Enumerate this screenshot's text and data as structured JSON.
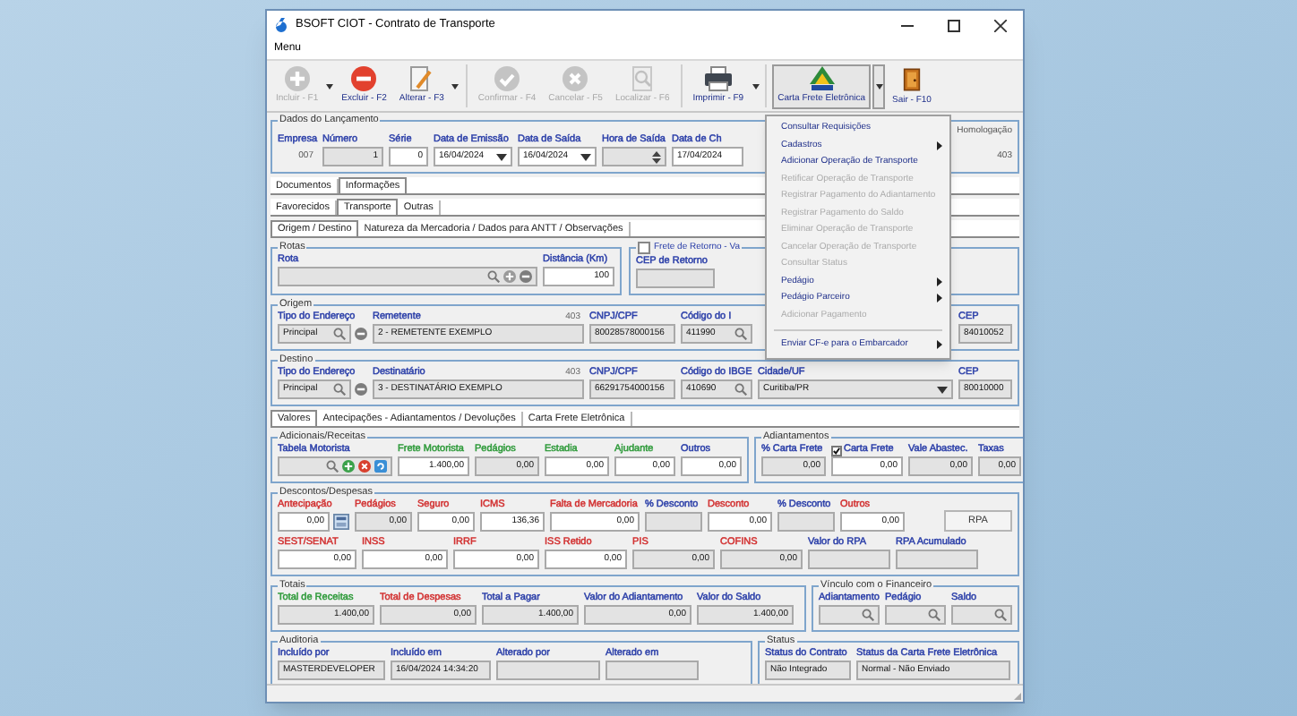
{
  "window": {
    "title": "BSOFT CIOT - Contrato de Transporte"
  },
  "menu_bar": [
    "Menu"
  ],
  "toolbar": [
    {
      "label": "Incluir - F1",
      "kind": "add",
      "disabled": true,
      "dropdown": true,
      "pressed": false
    },
    {
      "label": "Excluir - F2",
      "kind": "delete",
      "disabled": false,
      "dropdown": false,
      "pressed": false
    },
    {
      "label": "Alterar - F3",
      "kind": "edit",
      "disabled": false,
      "dropdown": true,
      "pressed": false
    },
    {
      "label": "Confirmar - F4",
      "kind": "confirm",
      "disabled": true,
      "dropdown": false,
      "pressed": false
    },
    {
      "label": "Cancelar - F5",
      "kind": "cancel",
      "disabled": true,
      "dropdown": false,
      "pressed": false
    },
    {
      "label": "Localizar - F6",
      "kind": "find",
      "disabled": true,
      "dropdown": false,
      "pressed": false
    },
    {
      "label": "Imprimir - F9",
      "kind": "print",
      "disabled": false,
      "dropdown": true,
      "pressed": false
    },
    {
      "label": "Carta Frete Eletrônica",
      "kind": "antt",
      "disabled": false,
      "dropdown": true,
      "pressed": true
    },
    {
      "label": "Sair - F10",
      "kind": "exit",
      "disabled": false,
      "dropdown": false,
      "pressed": false
    }
  ],
  "dados_lancamento": {
    "title": "Dados do Lançamento",
    "fields": [
      {
        "label": "Empresa",
        "value": "007",
        "kind": "static"
      },
      {
        "label": "Número",
        "value": "1",
        "kind": "number",
        "disabled": true
      },
      {
        "label": "Série",
        "value": "0",
        "kind": "number",
        "disabled": false
      },
      {
        "label": "Data de Emissão",
        "value": "16/04/2024",
        "kind": "date",
        "disabled": false
      },
      {
        "label": "Data de Saída",
        "value": "16/04/2024",
        "kind": "date",
        "disabled": false
      },
      {
        "label": "Hora de Saída",
        "kind": "time",
        "disabled": true
      },
      {
        "label": "Data de Ch",
        "value": "17/04/2024",
        "disabled": false
      }
    ],
    "homologacao": {
      "label": "Homologação",
      "value": "403"
    }
  },
  "tabs_main": [
    {
      "label": "Documentos",
      "selected": false
    },
    {
      "label": "Informações",
      "selected": true
    }
  ],
  "tabs_sub": [
    {
      "label": "Favorecidos",
      "selected": false
    },
    {
      "label": "Transporte",
      "selected": true
    },
    {
      "label": "Outras",
      "selected": false
    }
  ],
  "tabs_section": [
    {
      "label": "Origem / Destino",
      "selected": true
    },
    {
      "label": "Natureza da Mercadoria / Dados para ANTT / Observações",
      "selected": false
    }
  ],
  "rotas": {
    "title": "Rotas",
    "fields": [
      {
        "label": "Rota",
        "kind": "route",
        "disabled": true
      },
      {
        "label": "Distância (Km)",
        "value": "100",
        "kind": "number",
        "disabled": false
      }
    ]
  },
  "frete_retorno": {
    "label": "Frete de Retorno - Va",
    "checked": false,
    "fields": [
      {
        "label": "CEP de Retorno",
        "disabled": true
      }
    ]
  },
  "origem": {
    "title": "Origem",
    "fields": [
      {
        "label": "Tipo do Endereço",
        "value": "Principal",
        "kind": "address",
        "disabled": true
      },
      {
        "label": "Remetente",
        "value": "2 - REMETENTE EXEMPLO",
        "disabled": true,
        "note": "403"
      },
      {
        "label": "CNPJ/CPF",
        "value": "80028578000156",
        "disabled": true
      },
      {
        "label": "Código do I",
        "value": "411990",
        "kind": "lookup",
        "disabled": true
      },
      {
        "label": "CEP",
        "value": "84010052",
        "disabled": true
      }
    ]
  },
  "destino": {
    "title": "Destino",
    "fields": [
      {
        "label": "Tipo do Endereço",
        "value": "Principal",
        "kind": "address",
        "disabled": true
      },
      {
        "label": "Destinatário",
        "value": "3 - DESTINATÁRIO EXEMPLO",
        "disabled": true,
        "note": "403"
      },
      {
        "label": "CNPJ/CPF",
        "value": "66291754000156",
        "disabled": true
      },
      {
        "label": "Código do IBGE",
        "value": "410690",
        "kind": "lookup",
        "disabled": true
      },
      {
        "label": "Cidade/UF",
        "value": "Curitiba/PR",
        "kind": "combo",
        "disabled": true
      },
      {
        "label": "CEP",
        "value": "80010000",
        "disabled": true
      }
    ]
  },
  "tabs_values": [
    {
      "label": "Valores",
      "selected": true
    },
    {
      "label": "Antecipações - Adiantamentos / Devoluções",
      "selected": false
    },
    {
      "label": "Carta Frete Eletrônica",
      "selected": false
    }
  ],
  "adicionais": {
    "title": "Adicionais/Receitas",
    "fields": [
      {
        "label": "Tabela Motorista",
        "kind": "table",
        "disabled": true,
        "color": "#2a3ea8"
      },
      {
        "label": "Frete Motorista",
        "value": "1.400,00",
        "kind": "number",
        "disabled": false,
        "color": "#2e9a3a"
      },
      {
        "label": "Pedágios",
        "value": "0,00",
        "kind": "number",
        "disabled": true,
        "color": "#2e9a3a"
      },
      {
        "label": "Estadia",
        "value": "0,00",
        "kind": "number",
        "disabled": false,
        "color": "#2e9a3a"
      },
      {
        "label": "Ajudante",
        "value": "0,00",
        "kind": "number",
        "disabled": false,
        "color": "#2e9a3a"
      },
      {
        "label": "Outros",
        "value": "0,00",
        "kind": "number",
        "disabled": false,
        "color": "#2a3ea8"
      }
    ]
  },
  "adiantamentos": {
    "title": "Adiantamentos",
    "fields": [
      {
        "label": "% Carta Frete",
        "value": "0,00",
        "kind": "number",
        "disabled": true
      },
      {
        "label": "Carta Frete",
        "value": "0,00",
        "kind": "number",
        "disabled": false,
        "checked": true
      },
      {
        "label": "Vale Abastec.",
        "value": "0,00",
        "kind": "number",
        "disabled": true
      },
      {
        "label": "Taxas",
        "value": "0,00",
        "kind": "number",
        "disabled": true
      }
    ]
  },
  "descontos": {
    "title": "Descontos/Despesas",
    "fields_top": [
      {
        "label": "Antecipação",
        "value": "0,00",
        "kind": "advance",
        "disabled": false,
        "color": "#d23030"
      },
      {
        "label": "Pedágios",
        "value": "0,00",
        "kind": "number",
        "disabled": true,
        "color": "#d23030"
      },
      {
        "label": "Seguro",
        "value": "0,00",
        "kind": "number",
        "disabled": false,
        "color": "#d23030"
      },
      {
        "label": "ICMS",
        "value": "136,36",
        "kind": "number",
        "disabled": false,
        "color": "#d23030"
      },
      {
        "label": "Falta de Mercadoria",
        "value": "0,00",
        "kind": "number",
        "disabled": false,
        "color": "#d23030"
      },
      {
        "label": "% Desconto",
        "kind": "number",
        "disabled": true,
        "color": "#2a3ea8"
      },
      {
        "label": "Desconto",
        "value": "0,00",
        "kind": "number",
        "disabled": false,
        "color": "#d23030"
      },
      {
        "label": "% Desconto",
        "kind": "number",
        "disabled": true,
        "color": "#2a3ea8"
      },
      {
        "label": "Outros",
        "value": "0,00",
        "kind": "number",
        "disabled": false,
        "color": "#d23030"
      }
    ],
    "rpa_button": "RPA",
    "fields_bottom": [
      {
        "label": "SEST/SENAT",
        "value": "0,00",
        "kind": "number",
        "disabled": false,
        "color": "#d23030"
      },
      {
        "label": "INSS",
        "value": "0,00",
        "kind": "number",
        "disabled": false,
        "color": "#d23030"
      },
      {
        "label": "IRRF",
        "value": "0,00",
        "kind": "number",
        "disabled": false,
        "color": "#d23030"
      },
      {
        "label": "ISS Retido",
        "value": "0,00",
        "kind": "number",
        "disabled": false,
        "color": "#d23030"
      },
      {
        "label": "PIS",
        "value": "0,00",
        "kind": "number",
        "disabled": true,
        "color": "#d23030"
      },
      {
        "label": "COFINS",
        "value": "0,00",
        "kind": "number",
        "disabled": true,
        "color": "#d23030"
      },
      {
        "label": "Valor do RPA",
        "kind": "number",
        "disabled": true,
        "color": "#2a3ea8"
      },
      {
        "label": "RPA Acumulado",
        "kind": "number",
        "disabled": true,
        "color": "#2a3ea8"
      }
    ]
  },
  "totais": {
    "title": "Totais",
    "fields": [
      {
        "label": "Total de Receitas",
        "value": "1.400,00",
        "kind": "number",
        "disabled": true,
        "color": "#2e9a3a"
      },
      {
        "label": "Total de Despesas",
        "value": "0,00",
        "kind": "number",
        "disabled": true,
        "color": "#d23030"
      },
      {
        "label": "Total a Pagar",
        "value": "1.400,00",
        "kind": "number",
        "disabled": true,
        "color": "#2a3ea8"
      },
      {
        "label": "Valor do Adiantamento",
        "value": "0,00",
        "kind": "number",
        "disabled": true,
        "color": "#2a3ea8"
      },
      {
        "label": "Valor do Saldo",
        "value": "1.400,00",
        "kind": "number",
        "disabled": true,
        "color": "#2a3ea8"
      }
    ]
  },
  "vinculo": {
    "title": "Vínculo com o Financeiro",
    "fields": [
      {
        "label": "Adiantamento",
        "kind": "lookup",
        "disabled": true
      },
      {
        "label": "Pedágio",
        "kind": "lookup",
        "disabled": true
      },
      {
        "label": "Saldo",
        "kind": "lookup",
        "disabled": true
      }
    ]
  },
  "auditoria": {
    "title": "Auditoria",
    "fields": [
      {
        "label": "Incluído por",
        "value": "MASTERDEVELOPER",
        "disabled": true
      },
      {
        "label": "Incluído em",
        "value": "16/04/2024 14:34:20",
        "disabled": true
      },
      {
        "label": "Alterado por",
        "disabled": true
      },
      {
        "label": "Alterado em",
        "disabled": true
      }
    ]
  },
  "status": {
    "title": "Status",
    "fields": [
      {
        "label": "Status do Contrato",
        "value": "Não Integrado",
        "disabled": true
      },
      {
        "label": "Status da Carta Frete Eletrônica",
        "value": "Normal - Não Enviado",
        "disabled": true
      }
    ]
  },
  "context_menu": [
    {
      "kind": "item",
      "label": "Consultar Requisições",
      "disabled": false,
      "submenu": false
    },
    {
      "kind": "item",
      "label": "Cadastros",
      "disabled": false,
      "submenu": true
    },
    {
      "kind": "item",
      "label": "Adicionar Operação de Transporte",
      "disabled": false,
      "submenu": false
    },
    {
      "kind": "item",
      "label": "Retificar Operação de Transporte",
      "disabled": true,
      "submenu": false
    },
    {
      "kind": "item",
      "label": "Registrar Pagamento do Adiantamento",
      "disabled": true,
      "submenu": false
    },
    {
      "kind": "item",
      "label": "Registrar Pagamento do Saldo",
      "disabled": true,
      "submenu": false
    },
    {
      "kind": "item",
      "label": "Eliminar Operação de Transporte",
      "disabled": true,
      "submenu": false
    },
    {
      "kind": "item",
      "label": "Cancelar Operação de Transporte",
      "disabled": true,
      "submenu": false
    },
    {
      "kind": "item",
      "label": "Consultar Status",
      "disabled": true,
      "submenu": false
    },
    {
      "kind": "item",
      "label": "Pedágio",
      "disabled": false,
      "submenu": true
    },
    {
      "kind": "item",
      "label": "Pedágio Parceiro",
      "disabled": false,
      "submenu": true
    },
    {
      "kind": "item",
      "label": "Adicionar Pagamento",
      "disabled": true,
      "submenu": false
    },
    {
      "kind": "separator"
    },
    {
      "kind": "item",
      "label": "Enviar CF-e para o Embarcador",
      "disabled": false,
      "submenu": true
    }
  ]
}
